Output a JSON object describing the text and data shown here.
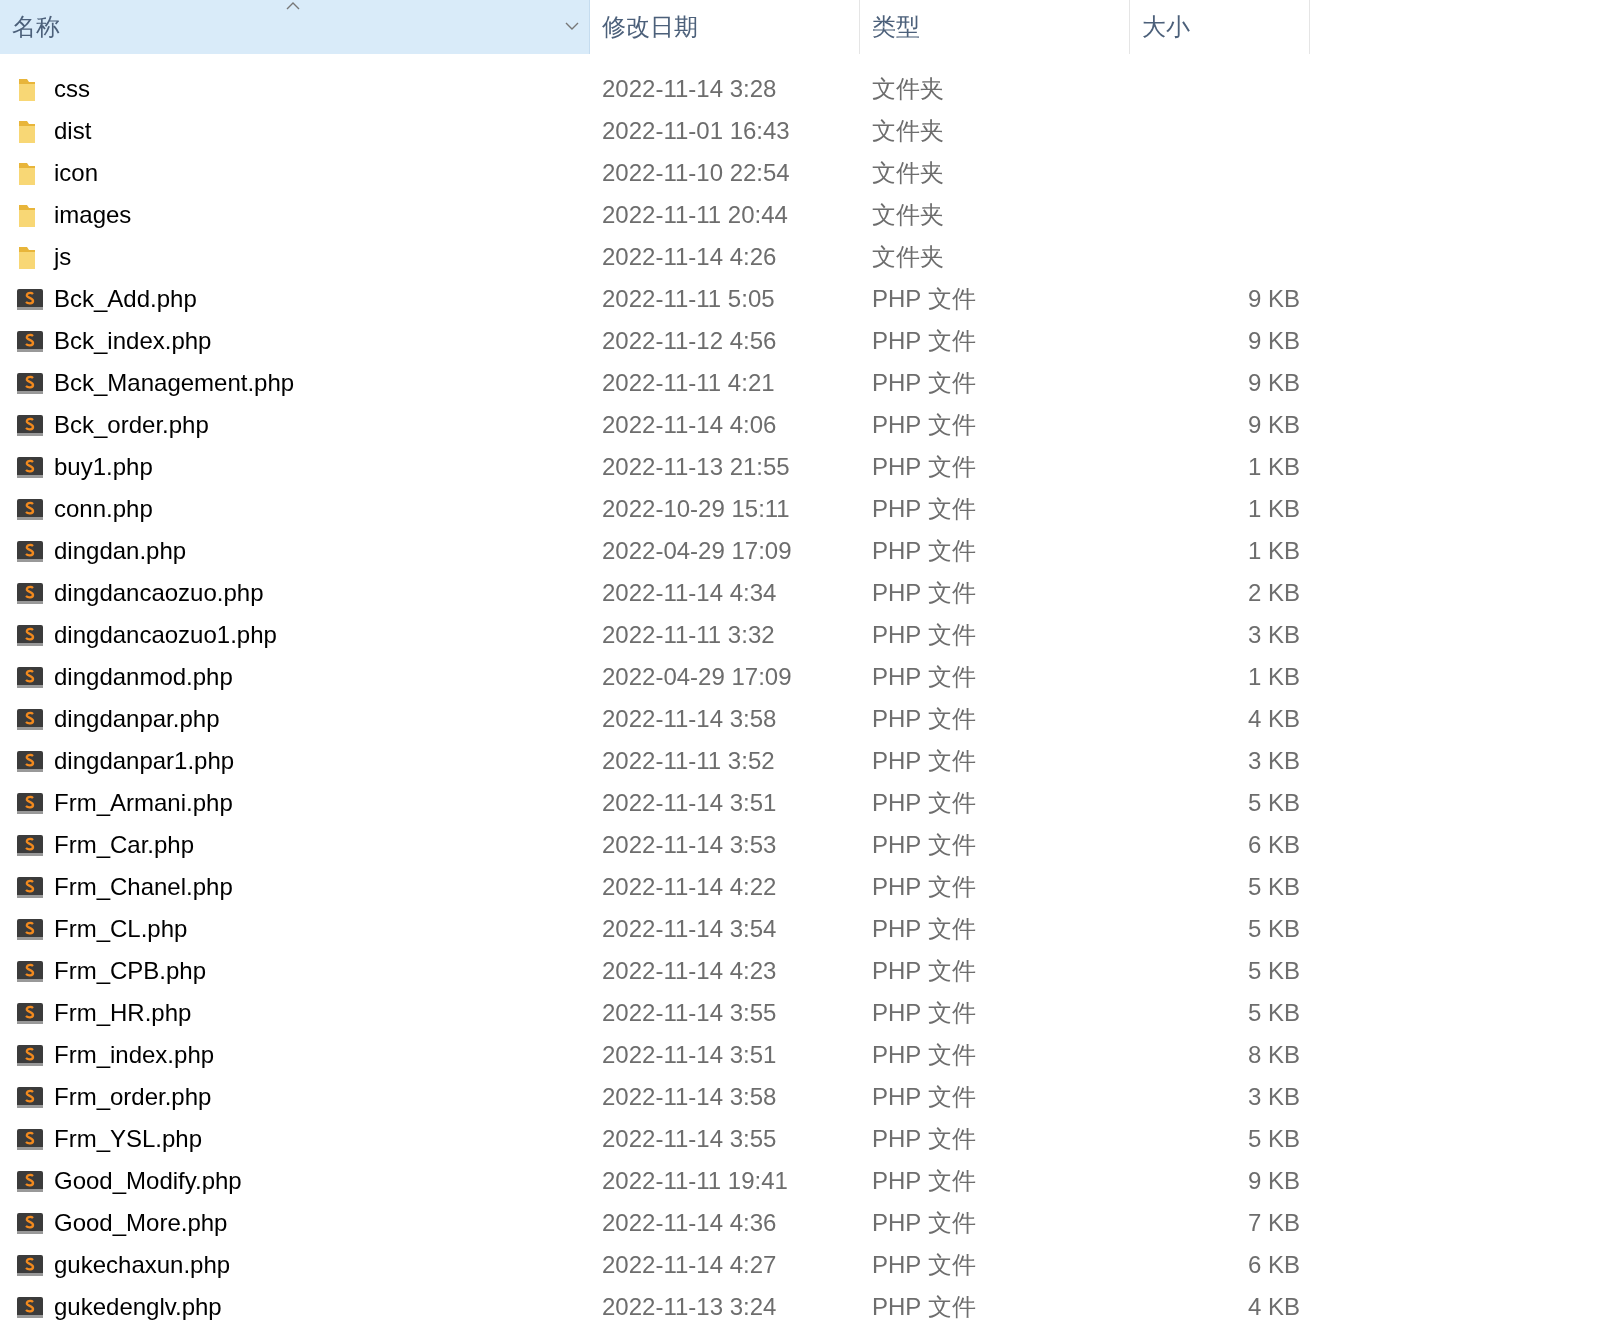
{
  "columns": [
    {
      "label": "名称",
      "selected": true,
      "sorted": true
    },
    {
      "label": "修改日期",
      "selected": false,
      "sorted": false
    },
    {
      "label": "类型",
      "selected": false,
      "sorted": false
    },
    {
      "label": "大小",
      "selected": false,
      "sorted": false
    }
  ],
  "rows": [
    {
      "kind": "folder",
      "name": "css",
      "date": "2022-11-14 3:28",
      "type": "文件夹"
    },
    {
      "kind": "folder",
      "name": "dist",
      "date": "2022-11-01 16:43",
      "type": "文件夹"
    },
    {
      "kind": "folder",
      "name": "icon",
      "date": "2022-11-10 22:54",
      "type": "文件夹"
    },
    {
      "kind": "folder",
      "name": "images",
      "date": "2022-11-11 20:44",
      "type": "文件夹"
    },
    {
      "kind": "folder",
      "name": "js",
      "date": "2022-11-14 4:26",
      "type": "文件夹"
    },
    {
      "kind": "php",
      "name": "Bck_Add.php",
      "date": "2022-11-11 5:05",
      "type": "PHP 文件",
      "size": "9 KB"
    },
    {
      "kind": "php",
      "name": "Bck_index.php",
      "date": "2022-11-12 4:56",
      "type": "PHP 文件",
      "size": "9 KB"
    },
    {
      "kind": "php",
      "name": "Bck_Management.php",
      "date": "2022-11-11 4:21",
      "type": "PHP 文件",
      "size": "9 KB"
    },
    {
      "kind": "php",
      "name": "Bck_order.php",
      "date": "2022-11-14 4:06",
      "type": "PHP 文件",
      "size": "9 KB"
    },
    {
      "kind": "php",
      "name": "buy1.php",
      "date": "2022-11-13 21:55",
      "type": "PHP 文件",
      "size": "1 KB"
    },
    {
      "kind": "php",
      "name": "conn.php",
      "date": "2022-10-29 15:11",
      "type": "PHP 文件",
      "size": "1 KB"
    },
    {
      "kind": "php",
      "name": "dingdan.php",
      "date": "2022-04-29 17:09",
      "type": "PHP 文件",
      "size": "1 KB"
    },
    {
      "kind": "php",
      "name": "dingdancaozuo.php",
      "date": "2022-11-14 4:34",
      "type": "PHP 文件",
      "size": "2 KB"
    },
    {
      "kind": "php",
      "name": "dingdancaozuo1.php",
      "date": "2022-11-11 3:32",
      "type": "PHP 文件",
      "size": "3 KB"
    },
    {
      "kind": "php",
      "name": "dingdanmod.php",
      "date": "2022-04-29 17:09",
      "type": "PHP 文件",
      "size": "1 KB"
    },
    {
      "kind": "php",
      "name": "dingdanpar.php",
      "date": "2022-11-14 3:58",
      "type": "PHP 文件",
      "size": "4 KB"
    },
    {
      "kind": "php",
      "name": "dingdanpar1.php",
      "date": "2022-11-11 3:52",
      "type": "PHP 文件",
      "size": "3 KB"
    },
    {
      "kind": "php",
      "name": "Frm_Armani.php",
      "date": "2022-11-14 3:51",
      "type": "PHP 文件",
      "size": "5 KB"
    },
    {
      "kind": "php",
      "name": "Frm_Car.php",
      "date": "2022-11-14 3:53",
      "type": "PHP 文件",
      "size": "6 KB"
    },
    {
      "kind": "php",
      "name": "Frm_Chanel.php",
      "date": "2022-11-14 4:22",
      "type": "PHP 文件",
      "size": "5 KB"
    },
    {
      "kind": "php",
      "name": "Frm_CL.php",
      "date": "2022-11-14 3:54",
      "type": "PHP 文件",
      "size": "5 KB"
    },
    {
      "kind": "php",
      "name": "Frm_CPB.php",
      "date": "2022-11-14 4:23",
      "type": "PHP 文件",
      "size": "5 KB"
    },
    {
      "kind": "php",
      "name": "Frm_HR.php",
      "date": "2022-11-14 3:55",
      "type": "PHP 文件",
      "size": "5 KB"
    },
    {
      "kind": "php",
      "name": "Frm_index.php",
      "date": "2022-11-14 3:51",
      "type": "PHP 文件",
      "size": "8 KB"
    },
    {
      "kind": "php",
      "name": "Frm_order.php",
      "date": "2022-11-14 3:58",
      "type": "PHP 文件",
      "size": "3 KB"
    },
    {
      "kind": "php",
      "name": "Frm_YSL.php",
      "date": "2022-11-14 3:55",
      "type": "PHP 文件",
      "size": "5 KB"
    },
    {
      "kind": "php",
      "name": "Good_Modify.php",
      "date": "2022-11-11 19:41",
      "type": "PHP 文件",
      "size": "9 KB"
    },
    {
      "kind": "php",
      "name": "Good_More.php",
      "date": "2022-11-14 4:36",
      "type": "PHP 文件",
      "size": "7 KB"
    },
    {
      "kind": "php",
      "name": "gukechaxun.php",
      "date": "2022-11-14 4:27",
      "type": "PHP 文件",
      "size": "6 KB"
    },
    {
      "kind": "php",
      "name": "gukedenglv.php",
      "date": "2022-11-13 3:24",
      "type": "PHP 文件",
      "size": "4 KB"
    }
  ]
}
